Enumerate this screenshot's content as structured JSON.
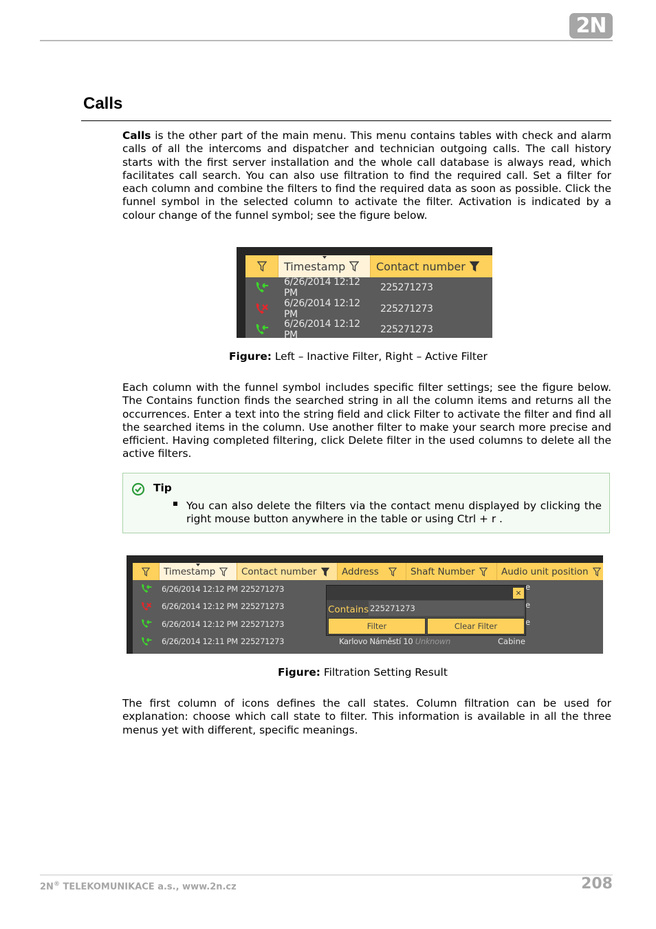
{
  "header": {
    "logo_text": "2N"
  },
  "section": {
    "title": "Calls"
  },
  "paragraphs": {
    "p1_bold": "Calls",
    "p1_rest": " is the other part of the main menu. This menu contains tables with check and alarm calls of all the intercoms and dispatcher and technician outgoing calls. The call history starts with the first server installation and the whole call database is always read, which facilitates call search. You can also use filtration to find the required call. Set a filter for each column and combine the filters to find the required data as soon as possible. Click the funnel symbol in the selected column to activate the filter. Activation is indicated by a colour change of the funnel symbol; see the figure below.",
    "p2": "Each column with the funnel symbol includes specific filter settings; see the figure below. The Contains function finds the searched string in all the column items and returns all the occurrences. Enter a text into the string field and click Filter to activate the filter and find all the searched items in the column. Use another filter to make your search more precise and efficient. Having completed filtering, click Delete filter in the used columns to delete all the active filters.",
    "p3": "The first column of icons defines the call states. Column filtration can be used for explanation: choose which call state to filter. This information is available in all the three menus yet with different, specific meanings."
  },
  "figure1": {
    "caption_bold": "Figure:",
    "caption_text": " Left – Inactive Filter, Right – Active Filter",
    "columns": [
      {
        "label": "",
        "filter": "inactive",
        "style": "yellow"
      },
      {
        "label": "Timestamp",
        "filter": "inactive",
        "style": "light",
        "sorted": true
      },
      {
        "label": "Contact number",
        "filter": "active",
        "style": "yellow"
      }
    ],
    "rows": [
      {
        "state": "incoming-answered",
        "timestamp": "6/26/2014 12:12 PM",
        "contact": "225271273"
      },
      {
        "state": "incoming-missed",
        "timestamp": "6/26/2014 12:12 PM",
        "contact": "225271273"
      },
      {
        "state": "incoming-answered",
        "timestamp": "6/26/2014 12:12 PM",
        "contact": "225271273"
      }
    ]
  },
  "tip": {
    "title": "Tip",
    "text": "You can also delete the filters via the contact menu displayed by clicking the right mouse button anywhere in the table or using Ctrl + r ."
  },
  "figure2": {
    "caption_bold": "Figure:",
    "caption_text": " Filtration Setting Result",
    "columns": [
      {
        "label": "",
        "filter": "inactive",
        "style": "yellow"
      },
      {
        "label": "Timestamp",
        "filter": "inactive",
        "style": "light",
        "sorted": true
      },
      {
        "label": "Contact number",
        "filter": "active",
        "style": "paleyellow"
      },
      {
        "label": "Address",
        "filter": "inactive",
        "style": "yellow"
      },
      {
        "label": "Shaft Number",
        "filter": "inactive",
        "style": "yellow"
      },
      {
        "label": "Audio unit position",
        "filter": "inactive",
        "style": "yellow"
      }
    ],
    "rows": [
      {
        "state": "incoming-answered",
        "timestamp": "6/26/2014 12:12 PM",
        "contact": "225271273"
      },
      {
        "state": "incoming-missed",
        "timestamp": "6/26/2014 12:12 PM",
        "contact": "225271273"
      },
      {
        "state": "incoming-answered",
        "timestamp": "6/26/2014 12:12 PM",
        "contact": "225271273"
      },
      {
        "state": "incoming-answered",
        "timestamp": "6/26/2014 12:11 PM",
        "contact": "225271273"
      }
    ],
    "last_row": {
      "address": "Karlovo Náměstí 10",
      "shaft": "Unknown",
      "audio_position": "Cabine"
    },
    "truncated_cell": "e",
    "popup": {
      "close_label": "×",
      "contains_label": "Contains",
      "contains_value": "225271273",
      "filter_button": "Filter",
      "clear_button": "Clear Filter"
    }
  },
  "colors": {
    "header_yellow": "#fdd15b",
    "header_light": "#fff3da",
    "table_bg": "#5b5b5b",
    "answered_green": "#3dd62b",
    "missed_red": "#e8262b",
    "tip_border": "#a9d3a9",
    "tip_icon_green": "#2b9b3a"
  },
  "footer": {
    "company_prefix": "2N",
    "registered": "®",
    "company_rest": " TELEKOMUNIKACE a.s., www.2n.cz",
    "page_number": "208"
  }
}
